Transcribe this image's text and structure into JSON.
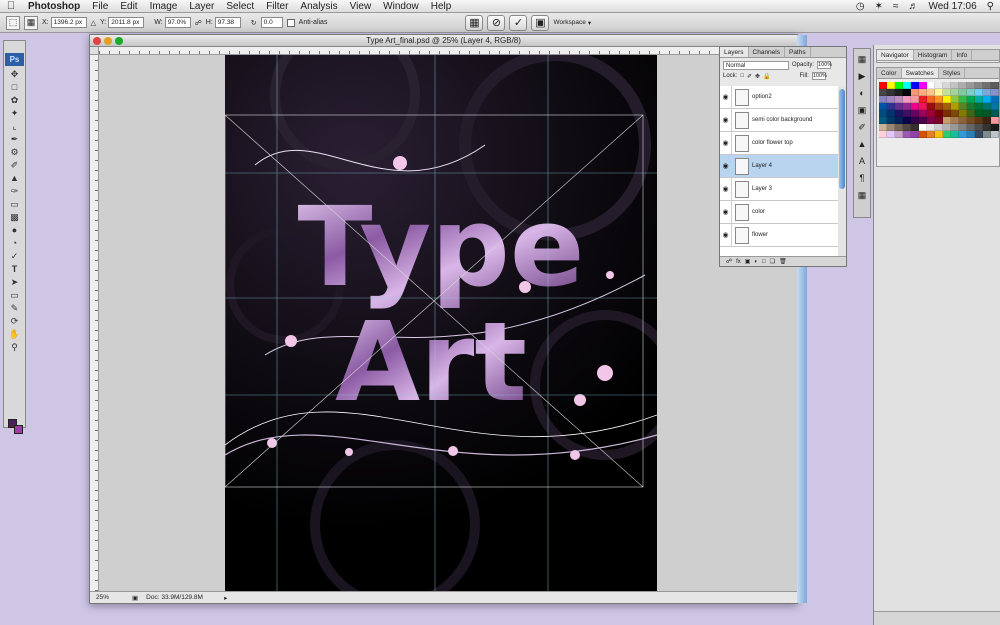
{
  "menubar": {
    "app": "Photoshop",
    "items": [
      "File",
      "Edit",
      "Image",
      "Layer",
      "Select",
      "Filter",
      "Analysis",
      "View",
      "Window",
      "Help"
    ],
    "clock": "Wed 17:06"
  },
  "options": {
    "x_label": "X:",
    "x_value": "1396.2 px",
    "y_label": "Y:",
    "y_value": "2011.8 px",
    "w_label": "W:",
    "w_value": "97.0%",
    "h_label": "H:",
    "h_value": "97.38",
    "angle_value": "0.0",
    "antialias": "Anti-alias",
    "workspace": "Workspace"
  },
  "tools": {
    "logo": "Ps"
  },
  "document": {
    "title": "Type Art_final.psd @ 25% (Layer 4, RGB/8)",
    "zoom": "25%",
    "doc_size": "Doc: 33.9M/129.8M",
    "art_line1": "Type",
    "art_line2": "Art"
  },
  "layers_panel": {
    "tabs": [
      "Layers",
      "Channels",
      "Paths"
    ],
    "blend_mode": "Normal",
    "opacity_label": "Opacity:",
    "opacity_value": "100%",
    "lock_label": "Lock:",
    "fill_label": "Fill:",
    "fill_value": "100%",
    "layers": [
      {
        "name": "option2",
        "selected": false
      },
      {
        "name": "semi color background",
        "selected": false
      },
      {
        "name": "color flower top",
        "selected": false
      },
      {
        "name": "Layer 4",
        "selected": true
      },
      {
        "name": "Layer 3",
        "selected": false
      },
      {
        "name": "color",
        "selected": false
      },
      {
        "name": "flower",
        "selected": false
      }
    ]
  },
  "right_panels": {
    "top_tabs": [
      "Navigator",
      "Histogram",
      "Info"
    ],
    "color_tabs": [
      "Color",
      "Swatches",
      "Styles"
    ]
  },
  "swatch_colors": [
    "#ff0000",
    "#ffff00",
    "#00ff00",
    "#00ffff",
    "#0000ff",
    "#ff00ff",
    "#ffffff",
    "#ebebeb",
    "#d6d6d6",
    "#c2c2c2",
    "#adadad",
    "#999999",
    "#858585",
    "#707070",
    "#5c5c5c",
    "#474747",
    "#333333",
    "#1f1f1f",
    "#000000",
    "#f7977a",
    "#f9ad81",
    "#fdc68a",
    "#fff79a",
    "#c4df9b",
    "#a2d39c",
    "#82ca9d",
    "#7bcdc8",
    "#6ecff6",
    "#7ea7d8",
    "#8493ca",
    "#8882be",
    "#a187be",
    "#bc8dbf",
    "#f49ac2",
    "#f6989d",
    "#ed1c24",
    "#f26522",
    "#f7941d",
    "#fff200",
    "#8dc73f",
    "#39b54a",
    "#00a651",
    "#00a99d",
    "#00aeef",
    "#0072bc",
    "#0054a6",
    "#2e3192",
    "#662d91",
    "#92278f",
    "#ec008c",
    "#ed145b",
    "#9e0b0f",
    "#a0410d",
    "#a36209",
    "#aba000",
    "#598527",
    "#1a7b30",
    "#007236",
    "#00746b",
    "#0076a3",
    "#004b80",
    "#003471",
    "#1b1464",
    "#440e62",
    "#630460",
    "#9e005d",
    "#9e0039",
    "#790000",
    "#7b2e00",
    "#7d4900",
    "#827b00",
    "#406618",
    "#005e20",
    "#005826",
    "#005952",
    "#005b7f",
    "#003663",
    "#002157",
    "#0d004c",
    "#32004b",
    "#4b0049",
    "#7b0046",
    "#7a0026",
    "#c69c6d",
    "#a67c52",
    "#8c6239",
    "#754c24",
    "#603913",
    "#3c2415",
    "#f5989d",
    "#c7b299",
    "#998675",
    "#736357",
    "#534741",
    "#37302a",
    "#ffffff",
    "#e6e6e6",
    "#cccccc",
    "#b3b3b3",
    "#999999",
    "#808080",
    "#666666",
    "#4d4d4d",
    "#333333",
    "#1a1a1a",
    "#ffd1dc",
    "#e2c6ff",
    "#c8a2c8",
    "#9b59b6",
    "#8e44ad",
    "#d35400",
    "#e67e22",
    "#f1c40f",
    "#2ecc71",
    "#1abc9c",
    "#3498db",
    "#2980b9",
    "#34495e",
    "#7f8c8d",
    "#bdc3c7"
  ]
}
